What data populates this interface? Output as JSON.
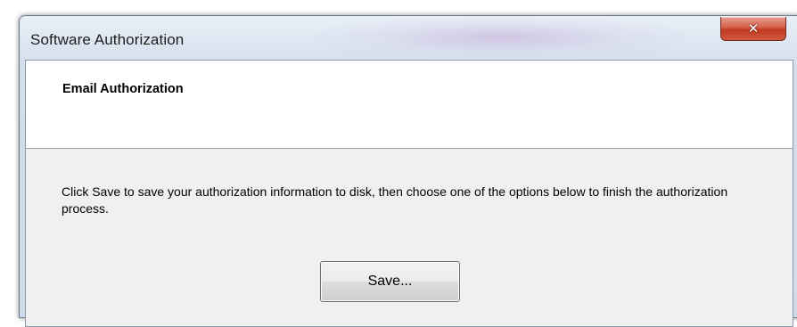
{
  "window": {
    "title": "Software Authorization",
    "close_glyph": "✕",
    "close_icon": "close-icon"
  },
  "header": {
    "title": "Email Authorization"
  },
  "content": {
    "instructions": "Click Save to save your authorization information to disk, then choose one of the options below to finish the authorization process."
  },
  "actions": {
    "save_label": "Save..."
  },
  "colors": {
    "close_button": "#c23a22",
    "client_background": "#f0f0f0",
    "header_background": "#ffffff"
  }
}
